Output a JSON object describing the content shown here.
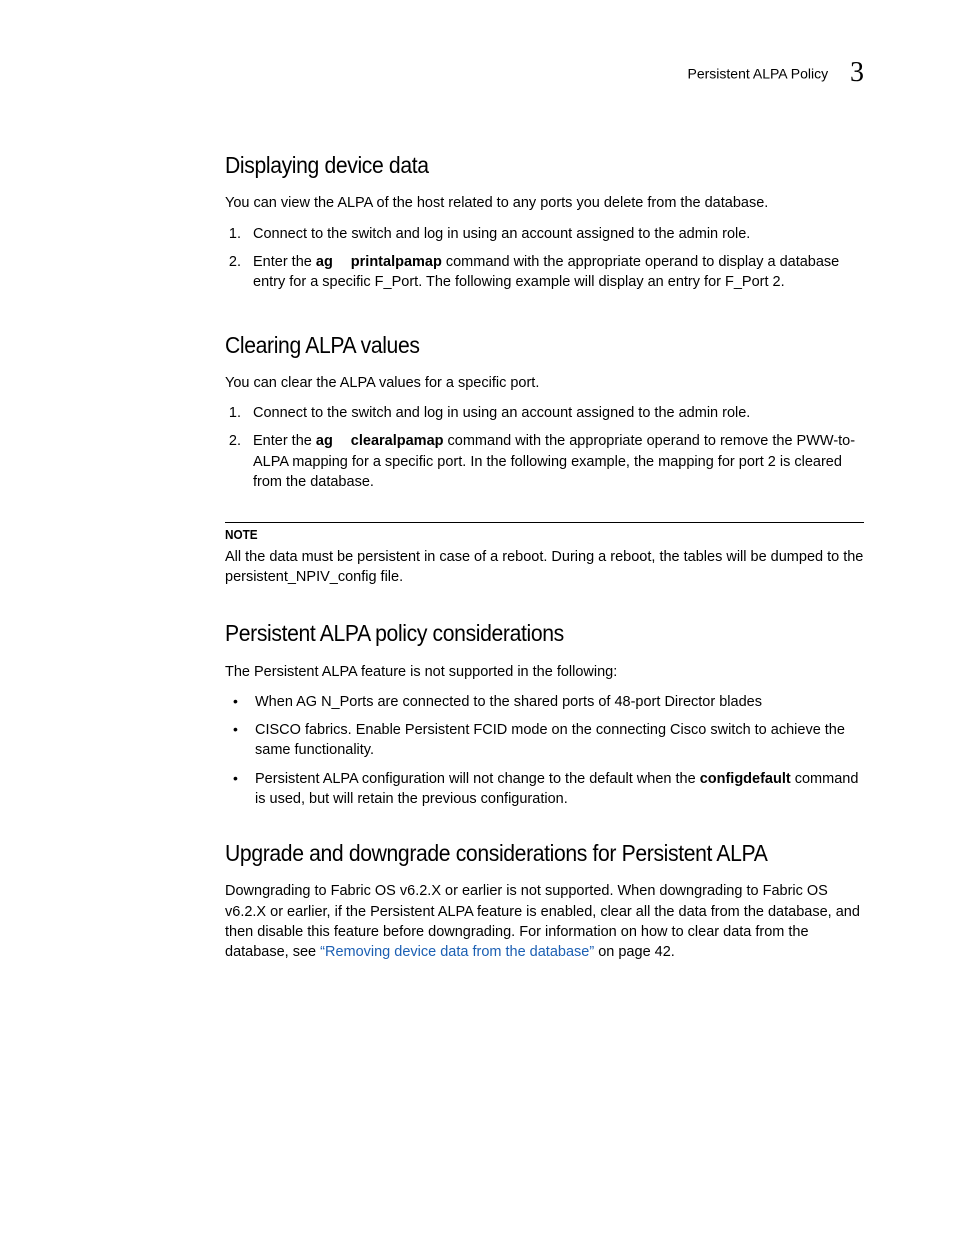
{
  "header": {
    "title": "Persistent ALPA Policy",
    "chapter": "3"
  },
  "s1": {
    "heading": "Displaying device data",
    "intro": "You can view the ALPA of the host related to any ports you delete from the database.",
    "step1": "Connect to the switch and log in using an account assigned to the admin role.",
    "step2a": "Enter the ",
    "step2cmd1": "ag",
    "step2cmd2": "printalpamap",
    "step2b": " command with the appropriate operand to display a database entry for a specific F_Port. The following example will display an entry for F_Port 2."
  },
  "s2": {
    "heading": "Clearing ALPA values",
    "intro": "You can clear the ALPA values for a specific port.",
    "step1": "Connect to the switch and log in using an account assigned to the admin role.",
    "step2a": "Enter the ",
    "step2cmd1": "ag",
    "step2cmd2": "clearalpamap",
    "step2b": " command with the appropriate operand to remove the PWW-to-ALPA mapping for a specific port. In the following example, the mapping for port 2 is cleared from the database."
  },
  "note": {
    "label": "NOTE",
    "body": "All the data must be persistent in case of a reboot. During a reboot, the tables will be dumped to the persistent_NPIV_config file."
  },
  "s3": {
    "heading": "Persistent ALPA policy considerations",
    "intro": "The Persistent ALPA feature is not supported in the following:",
    "b1": "When AG N_Ports are connected to the shared ports of 48-port Director blades",
    "b2": "CISCO fabrics. Enable Persistent FCID mode on the connecting Cisco switch to achieve the same functionality.",
    "b3a": "Persistent ALPA configuration will not change to the default when the ",
    "b3cmd": "configdefault",
    "b3b": " command is used, but will retain the previous configuration."
  },
  "s4": {
    "heading": "Upgrade and downgrade considerations for Persistent ALPA",
    "p1a": "Downgrading to Fabric OS v6.2.X or earlier is not supported. When downgrading to Fabric OS v6.2.X or earlier, if the Persistent ALPA feature is enabled, clear all the data from the database, and then disable this feature before downgrading. For information on how to clear data from the database, see ",
    "link": "“Removing device data from the database”",
    "p1b": " on page 42."
  }
}
